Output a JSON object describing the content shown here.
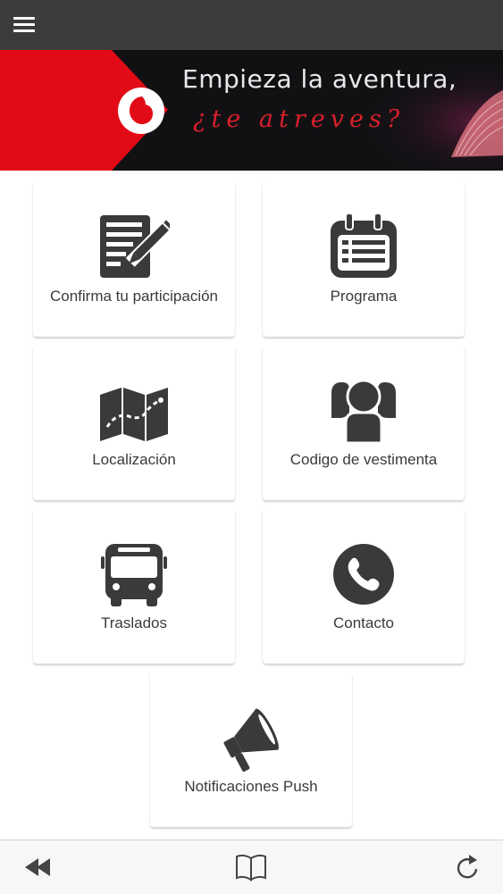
{
  "banner": {
    "line1": "Empieza la aventura,",
    "line2": "¿te atreves?"
  },
  "menu": [
    {
      "label": "Confirma tu participación",
      "icon": "edit-document-icon"
    },
    {
      "label": "Programa",
      "icon": "calendar-list-icon"
    },
    {
      "label": "Localización",
      "icon": "map-icon"
    },
    {
      "label": "Codigo de vestimenta",
      "icon": "people-icon"
    },
    {
      "label": "Traslados",
      "icon": "bus-icon"
    },
    {
      "label": "Contacto",
      "icon": "phone-icon"
    },
    {
      "label": "Notificaciones Push",
      "icon": "megaphone-icon"
    }
  ],
  "toolbar": {
    "back_icon": "rewind-icon",
    "bookmarks_icon": "book-icon",
    "reload_icon": "reload-icon"
  },
  "colors": {
    "topbar": "#3b3d3d",
    "brand_red": "#e20a16",
    "icon": "#3a3a3a"
  }
}
